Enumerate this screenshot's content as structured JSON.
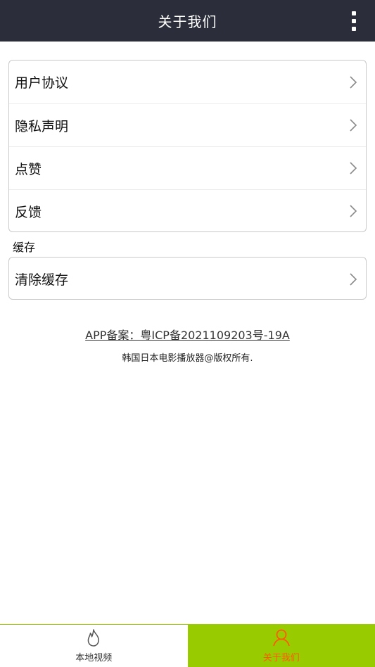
{
  "header": {
    "title": "关于我们",
    "menu_icon": "more-vertical-icon"
  },
  "settings_list": {
    "items": [
      {
        "label": "用户协议"
      },
      {
        "label": "隐私声明"
      },
      {
        "label": "点赞"
      },
      {
        "label": "反馈"
      }
    ]
  },
  "cache_section": {
    "label": "缓存",
    "items": [
      {
        "label": "清除缓存"
      }
    ]
  },
  "footer": {
    "icp": "APP备案：粤ICP备2021109203号-19A",
    "copyright": "韩国日本电影播放器@版权所有."
  },
  "tab_bar": {
    "tabs": [
      {
        "label": "本地视频",
        "icon": "flame-icon"
      },
      {
        "label": "关于我们",
        "icon": "user-icon",
        "active": true
      }
    ],
    "colors": {
      "active_bg": "#99cc00",
      "active_text": "#ff5a00",
      "header_bg": "#2b2d3a"
    }
  }
}
